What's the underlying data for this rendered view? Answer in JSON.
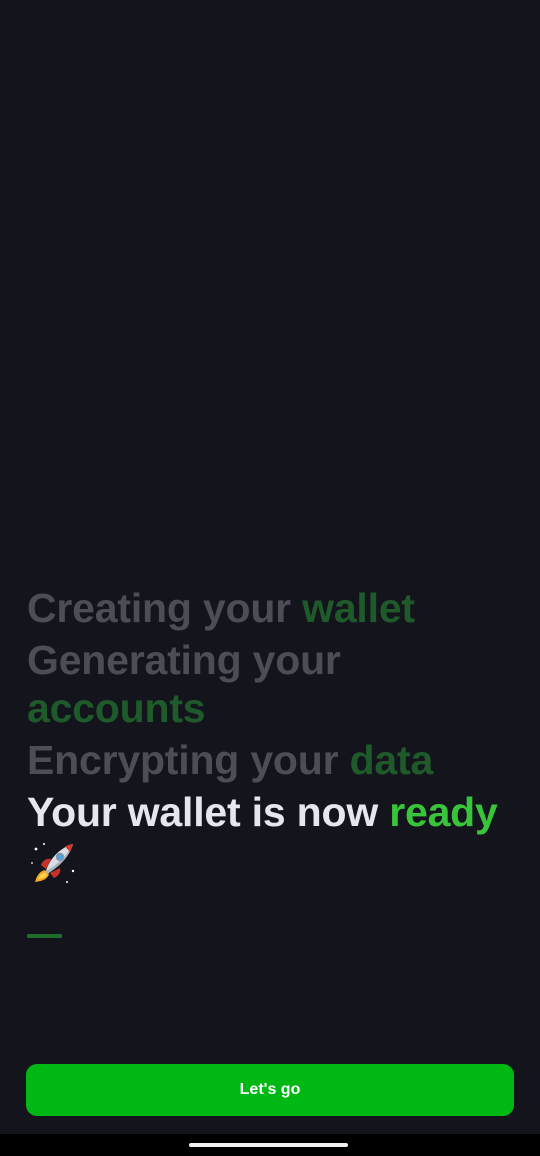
{
  "steps": [
    {
      "prefix": "Creating your ",
      "highlight": "wallet",
      "state": "done"
    },
    {
      "prefix": "Generating your ",
      "highlight": "accounts",
      "state": "done"
    },
    {
      "prefix": "Encrypting your ",
      "highlight": "data",
      "state": "done"
    },
    {
      "prefix": "Your wallet is now ",
      "highlight": "ready",
      "state": "active"
    }
  ],
  "icons": {
    "rocket": "rocket-icon"
  },
  "cta": {
    "label": "Let's go"
  },
  "colors": {
    "background": "#14151c",
    "text_done": "#4c4d56",
    "highlight_done": "#1f5a2a",
    "text_active": "#e6e6ee",
    "highlight_active": "#39c53b",
    "button": "#00b813",
    "progress_dash": "#1f6a2c"
  }
}
